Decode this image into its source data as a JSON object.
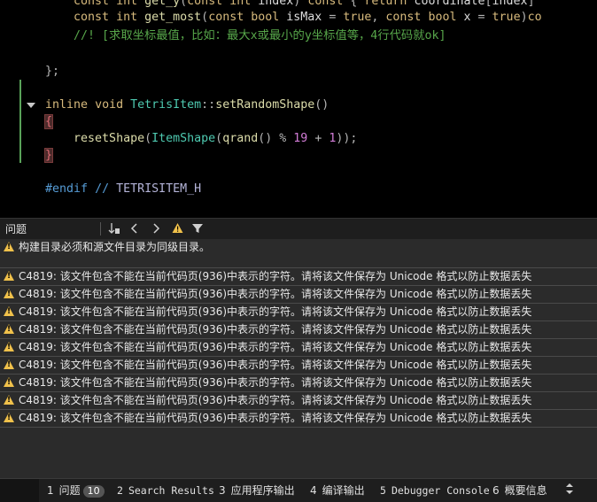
{
  "editor": {
    "lines": [
      {
        "kind": "decl_y",
        "text": "const int get_y(const int index) const { return coordinate[index]"
      },
      {
        "kind": "decl_most",
        "text": "const int get_most(const bool isMax = true, const bool x = true)co"
      },
      {
        "kind": "comment",
        "text": "//! [求取坐标最值，比如：最大x或最小的y坐标值等，4行代码就ok]"
      },
      {
        "kind": "blank",
        "text": ""
      },
      {
        "kind": "close",
        "text": "};"
      },
      {
        "kind": "blank",
        "text": ""
      },
      {
        "kind": "fn_sig",
        "text": "inline void TetrisItem::setRandomShape()"
      },
      {
        "kind": "brace_open",
        "text": "{"
      },
      {
        "kind": "blank",
        "text": ""
      },
      {
        "kind": "call",
        "text": "resetShape(ItemShape(qrand() % 19 + 1));"
      },
      {
        "kind": "brace_close",
        "text": "}"
      },
      {
        "kind": "blank",
        "text": ""
      },
      {
        "kind": "endif",
        "text": "#endif // TETRISITEM_H"
      }
    ]
  },
  "problems": {
    "title": "问题",
    "toolbar": {
      "sort_icon": "sort-icon",
      "prev_icon": "chevron-left-icon",
      "next_icon": "chevron-right-icon",
      "warning_filter_icon": "warning-icon",
      "filter_icon": "filter-icon"
    },
    "items": [
      {
        "severity": "warning",
        "text": "构建目录必须和源文件目录为同级目录。"
      },
      {
        "severity": "warning",
        "text": "C4819: 该文件包含不能在当前代码页(936)中表示的字符。请将该文件保存为 Unicode 格式以防止数据丢失"
      },
      {
        "severity": "warning",
        "text": "C4819: 该文件包含不能在当前代码页(936)中表示的字符。请将该文件保存为 Unicode 格式以防止数据丢失"
      },
      {
        "severity": "warning",
        "text": "C4819: 该文件包含不能在当前代码页(936)中表示的字符。请将该文件保存为 Unicode 格式以防止数据丢失"
      },
      {
        "severity": "warning",
        "text": "C4819: 该文件包含不能在当前代码页(936)中表示的字符。请将该文件保存为 Unicode 格式以防止数据丢失"
      },
      {
        "severity": "warning",
        "text": "C4819: 该文件包含不能在当前代码页(936)中表示的字符。请将该文件保存为 Unicode 格式以防止数据丢失"
      },
      {
        "severity": "warning",
        "text": "C4819: 该文件包含不能在当前代码页(936)中表示的字符。请将该文件保存为 Unicode 格式以防止数据丢失"
      },
      {
        "severity": "warning",
        "text": "C4819: 该文件包含不能在当前代码页(936)中表示的字符。请将该文件保存为 Unicode 格式以防止数据丢失"
      },
      {
        "severity": "warning",
        "text": "C4819: 该文件包含不能在当前代码页(936)中表示的字符。请将该文件保存为 Unicode 格式以防止数据丢失"
      },
      {
        "severity": "warning",
        "text": "C4819: 该文件包含不能在当前代码页(936)中表示的字符。请将该文件保存为 Unicode 格式以防止数据丢失"
      }
    ]
  },
  "output_tabs": [
    {
      "number": "1",
      "label": "问题",
      "badge": "10",
      "mono": false
    },
    {
      "number": "2",
      "label": "Search Results",
      "badge": "",
      "mono": true
    },
    {
      "number": "3",
      "label": "应用程序输出",
      "badge": "",
      "mono": false
    },
    {
      "number": "4",
      "label": "编译输出",
      "badge": "",
      "mono": false
    },
    {
      "number": "5",
      "label": "Debugger Console",
      "badge": "",
      "mono": true
    },
    {
      "number": "6",
      "label": "概要信息",
      "badge": "",
      "mono": false
    }
  ],
  "colors": {
    "keyword": "#d7ba7d",
    "type": "#4ec9b0",
    "function": "#dcdcaa",
    "number": "#d27cd6",
    "comment": "#57a64a",
    "preprocessor": "#569cd6",
    "warning": "#f0c14b"
  }
}
